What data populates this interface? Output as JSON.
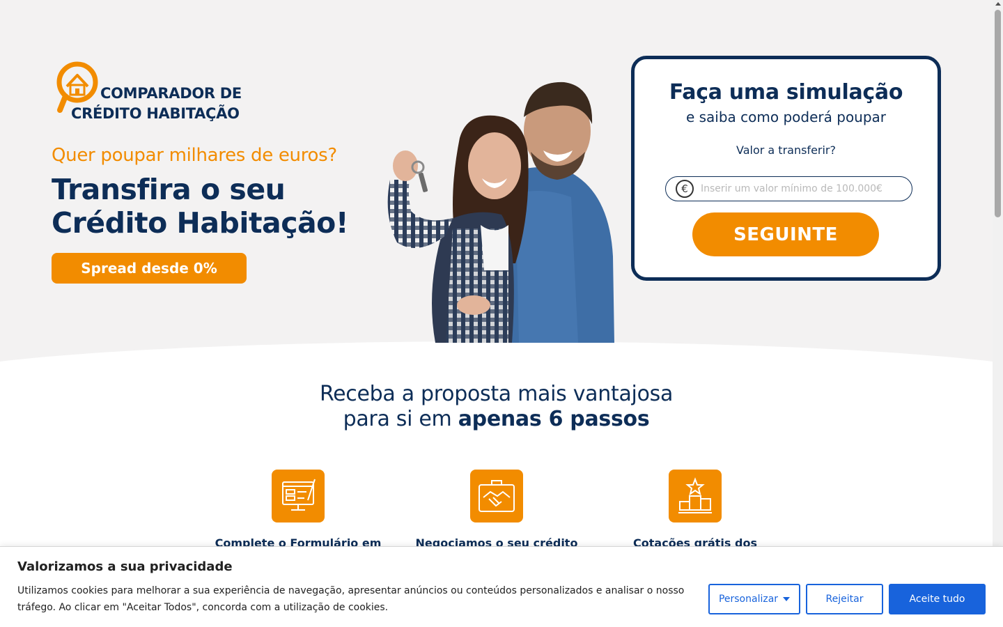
{
  "logo": {
    "line1": "COMPARADOR DE",
    "line2": "CRÉDITO HABITAÇÃO",
    "icon": "magnifier-house-icon"
  },
  "hero": {
    "subheadline": "Quer poupar milhares de euros?",
    "headline_line1": "Transfira o seu",
    "headline_line2": "Crédito Habitação!",
    "spread_badge": "Spread desde 0%",
    "photo_alt": "couple-with-keys"
  },
  "simulation": {
    "title": "Faça uma simulação",
    "subtitle": "e saiba como poderá poupar",
    "label": "Valor a transferir?",
    "input_placeholder": "Inserir um valor mínimo de 100.000€",
    "input_value": "",
    "currency_symbol": "€",
    "button_label": "SEGUINTE"
  },
  "steps": {
    "title_line1": "Receba a proposta mais vantajosa",
    "title_line2_plain": "para si em ",
    "title_line2_bold": "apenas 6 passos",
    "items": [
      {
        "label": "Complete o Formulário em",
        "icon": "form-screen-icon"
      },
      {
        "label": "Negociamos o seu crédito",
        "icon": "briefcase-handshake-icon"
      },
      {
        "label": "Cotações grátis dos",
        "icon": "podium-star-icon"
      }
    ]
  },
  "cookie": {
    "title": "Valorizamos a sua privacidade",
    "text": "Utilizamos cookies para melhorar a sua experiência de navegação, apresentar anúncios ou conteúdos personalizados e analisar o nosso tráfego. Ao clicar em \"Aceitar Todos\", concorda com a utilização de cookies.",
    "customize_label": "Personalizar",
    "reject_label": "Rejeitar",
    "accept_label": "Aceite tudo"
  },
  "colors": {
    "navy": "#0d2d57",
    "orange": "#f28c00",
    "hero_bg": "#f3f2f2",
    "cookie_blue": "#1863dc"
  }
}
